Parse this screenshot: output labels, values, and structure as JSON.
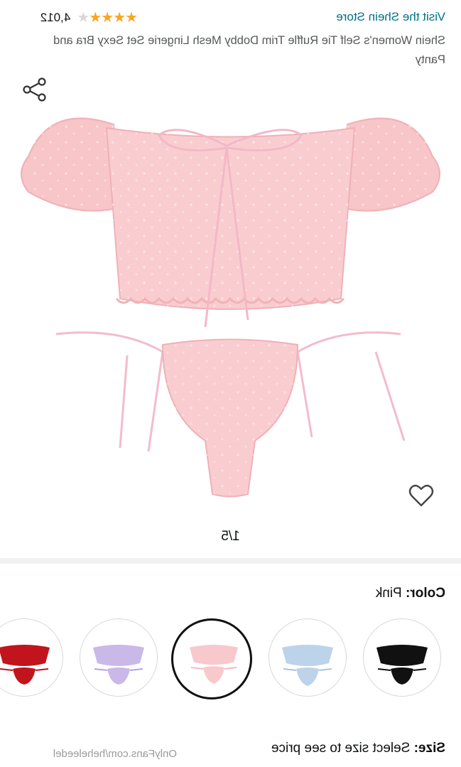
{
  "header": {
    "store_link": "Visit the Shein Store",
    "rating_value": 4,
    "rating_count": "4,012",
    "title": "Shein Women's Self Tie Ruffle Trim Dobby Mesh Lingerie Set Sexy Bra and Panty"
  },
  "gallery": {
    "counter": "1/5"
  },
  "color": {
    "label": "Color:",
    "value": "Pink",
    "swatches": [
      {
        "name": "Black",
        "hex": "#111111"
      },
      {
        "name": "Light Blue",
        "hex": "#bcd3ea"
      },
      {
        "name": "Pink",
        "hex": "#f7c9cc",
        "selected": true
      },
      {
        "name": "Lavender",
        "hex": "#c9b8e8"
      },
      {
        "name": "Red",
        "hex": "#c2141c"
      }
    ]
  },
  "size": {
    "label": "Size:",
    "value": "Select size to see price"
  },
  "watermark": "OnlyFans.com/heheleedel"
}
